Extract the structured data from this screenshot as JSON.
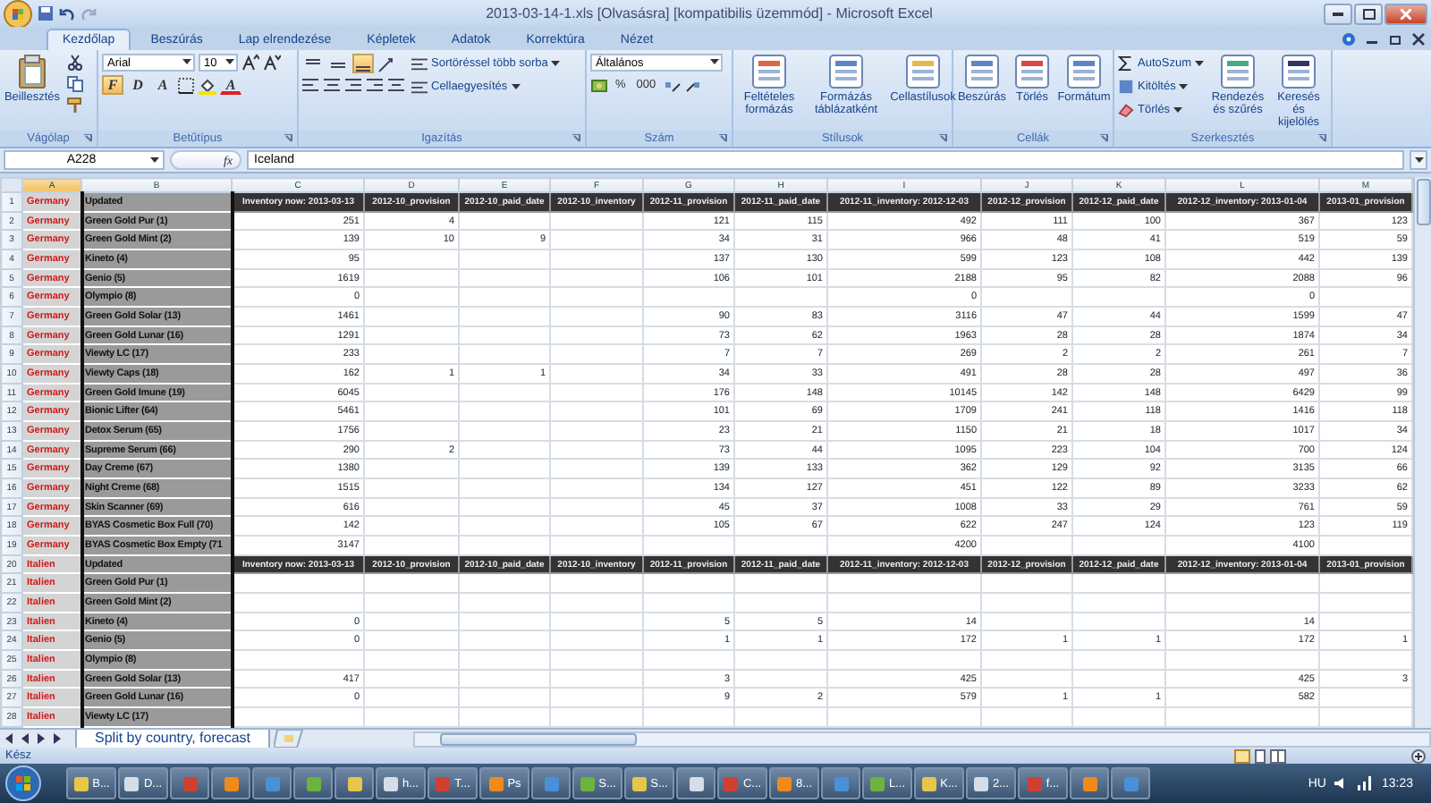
{
  "window": {
    "title": "2013-03-14-1.xls  [Olvasásra]  [kompatibilis üzemmód] - Microsoft Excel"
  },
  "ribbon": {
    "tabs": [
      {
        "label": "Kezdőlap",
        "selected": true
      },
      {
        "label": "Beszúrás",
        "selected": false
      },
      {
        "label": "Lap elrendezése",
        "selected": false
      },
      {
        "label": "Képletek",
        "selected": false
      },
      {
        "label": "Adatok",
        "selected": false
      },
      {
        "label": "Korrektúra",
        "selected": false
      },
      {
        "label": "Nézet",
        "selected": false
      }
    ],
    "groups": [
      {
        "title": "Vágólap",
        "buttons": [
          "Beillesztés"
        ]
      },
      {
        "title": "Betűtípus",
        "font": "Arial",
        "size": "10",
        "styles": [
          {
            "label": "F",
            "pressed": true
          },
          {
            "label": "D",
            "pressed": false
          },
          {
            "label": "A",
            "pressed": false
          }
        ],
        "font_color": "A"
      },
      {
        "title": "Igazítás",
        "alignments": [
          {
            "selected": false
          },
          {
            "selected": false
          },
          {
            "selected": true
          }
        ],
        "buttons": [
          "Sortöréssel több sorba",
          "Cellaegyesítés"
        ]
      },
      {
        "title": "Szám",
        "format": "Általános",
        "buttons": [
          "%",
          "000"
        ]
      },
      {
        "title": "Stílusok",
        "buttons": [
          "Feltételes formázás",
          "Formázás táblázatként",
          "Cellastílusok"
        ]
      },
      {
        "title": "Cellák",
        "buttons": [
          "Beszúrás",
          "Törlés",
          "Formátum"
        ]
      },
      {
        "title": "Szerkesztés",
        "buttons": [
          "AutoSzum",
          "Kitöltés",
          "Törlés",
          "Rendezés és szűrés",
          "Keresés és kijelölés"
        ]
      }
    ]
  },
  "formula_bar": {
    "name_box": "A228",
    "fx": "fx",
    "value": "Iceland"
  },
  "columns": [
    {
      "letter": "A",
      "selected": true
    },
    {
      "letter": "B",
      "selected": false
    },
    {
      "letter": "C",
      "selected": false
    },
    {
      "letter": "D",
      "selected": false
    },
    {
      "letter": "E",
      "selected": false
    },
    {
      "letter": "F",
      "selected": false
    },
    {
      "letter": "G",
      "selected": false
    },
    {
      "letter": "H",
      "selected": false
    },
    {
      "letter": "I",
      "selected": false
    },
    {
      "letter": "J",
      "selected": false
    },
    {
      "letter": "K",
      "selected": false
    },
    {
      "letter": "L",
      "selected": false
    },
    {
      "letter": "M",
      "selected": false
    }
  ],
  "rows": [
    {
      "number": "1",
      "kind": "header",
      "cells": [
        "Germany",
        "Updated",
        "Inventory now: 2013-03-13",
        "2012-10_provision",
        "2012-10_paid_date",
        "2012-10_inventory",
        "2012-11_provision",
        "2012-11_paid_date",
        "2012-11_inventory: 2012-12-03",
        "2012-12_provision",
        "2012-12_paid_date",
        "2012-12_inventory: 2013-01-04",
        "2013-01_provision"
      ]
    },
    {
      "number": "2",
      "kind": "data",
      "cells": [
        "Germany",
        "Green Gold Pur (1)",
        "251",
        "4",
        null,
        null,
        "121",
        "115",
        "492",
        "111",
        "100",
        "367",
        "123"
      ]
    },
    {
      "number": "3",
      "kind": "data",
      "cells": [
        "Germany",
        "Green Gold Mint (2)",
        "139",
        "10",
        "9",
        null,
        "34",
        "31",
        "966",
        "48",
        "41",
        "519",
        "59"
      ]
    },
    {
      "number": "4",
      "kind": "data",
      "cells": [
        "Germany",
        "Kineto (4)",
        "95",
        null,
        null,
        null,
        "137",
        "130",
        "599",
        "123",
        "108",
        "442",
        "139"
      ]
    },
    {
      "number": "5",
      "kind": "data",
      "cells": [
        "Germany",
        "Genio (5)",
        "1619",
        null,
        null,
        null,
        "106",
        "101",
        "2188",
        "95",
        "82",
        "2088",
        "96"
      ]
    },
    {
      "number": "6",
      "kind": "data",
      "cells": [
        "Germany",
        "Olympio (8)",
        "0",
        null,
        null,
        null,
        null,
        null,
        "0",
        null,
        null,
        "0",
        null
      ]
    },
    {
      "number": "7",
      "kind": "data",
      "cells": [
        "Germany",
        "Green Gold Solar (13)",
        "1461",
        null,
        null,
        null,
        "90",
        "83",
        "3116",
        "47",
        "44",
        "1599",
        "47"
      ]
    },
    {
      "number": "8",
      "kind": "data",
      "cells": [
        "Germany",
        "Green Gold Lunar (16)",
        "1291",
        null,
        null,
        null,
        "73",
        "62",
        "1963",
        "28",
        "28",
        "1874",
        "34"
      ]
    },
    {
      "number": "9",
      "kind": "data",
      "cells": [
        "Germany",
        "Viewty LC (17)",
        "233",
        null,
        null,
        null,
        "7",
        "7",
        "269",
        "2",
        "2",
        "261",
        "7"
      ]
    },
    {
      "number": "10",
      "kind": "data",
      "cells": [
        "Germany",
        "Viewty Caps (18)",
        "162",
        "1",
        "1",
        null,
        "34",
        "33",
        "491",
        "28",
        "28",
        "497",
        "36"
      ]
    },
    {
      "number": "11",
      "kind": "data",
      "cells": [
        "Germany",
        "Green Gold Imune (19)",
        "6045",
        null,
        null,
        null,
        "176",
        "148",
        "10145",
        "142",
        "148",
        "6429",
        "99"
      ]
    },
    {
      "number": "12",
      "kind": "data",
      "cells": [
        "Germany",
        "Bionic Lifter (64)",
        "5461",
        null,
        null,
        null,
        "101",
        "69",
        "1709",
        "241",
        "118",
        "1416",
        "118"
      ]
    },
    {
      "number": "13",
      "kind": "data",
      "cells": [
        "Germany",
        "Detox Serum (65)",
        "1756",
        null,
        null,
        null,
        "23",
        "21",
        "1150",
        "21",
        "18",
        "1017",
        "34"
      ]
    },
    {
      "number": "14",
      "kind": "data",
      "cells": [
        "Germany",
        "Supreme Serum (66)",
        "290",
        "2",
        null,
        null,
        "73",
        "44",
        "1095",
        "223",
        "104",
        "700",
        "124"
      ]
    },
    {
      "number": "15",
      "kind": "data",
      "cells": [
        "Germany",
        "Day Creme (67)",
        "1380",
        null,
        null,
        null,
        "139",
        "133",
        "362",
        "129",
        "92",
        "3135",
        "66"
      ]
    },
    {
      "number": "16",
      "kind": "data",
      "cells": [
        "Germany",
        "Night Creme (68)",
        "1515",
        null,
        null,
        null,
        "134",
        "127",
        "451",
        "122",
        "89",
        "3233",
        "62"
      ]
    },
    {
      "number": "17",
      "kind": "data",
      "cells": [
        "Germany",
        "Skin Scanner (69)",
        "616",
        null,
        null,
        null,
        "45",
        "37",
        "1008",
        "33",
        "29",
        "761",
        "59"
      ]
    },
    {
      "number": "18",
      "kind": "data",
      "cells": [
        "Germany",
        "BYAS Cosmetic Box Full (70)",
        "142",
        null,
        null,
        null,
        "105",
        "67",
        "622",
        "247",
        "124",
        "123",
        "119"
      ]
    },
    {
      "number": "19",
      "kind": "data",
      "cells": [
        "Germany",
        "BYAS Cosmetic Box Empty (71",
        "3147",
        null,
        null,
        null,
        null,
        null,
        "4200",
        null,
        null,
        "4100",
        null
      ]
    },
    {
      "number": "20",
      "kind": "header",
      "cells": [
        "Italien",
        "Updated",
        "Inventory now: 2013-03-13",
        "2012-10_provision",
        "2012-10_paid_date",
        "2012-10_inventory",
        "2012-11_provision",
        "2012-11_paid_date",
        "2012-11_inventory: 2012-12-03",
        "2012-12_provision",
        "2012-12_paid_date",
        "2012-12_inventory: 2013-01-04",
        "2013-01_provision"
      ]
    },
    {
      "number": "21",
      "kind": "data",
      "cells": [
        "Italien",
        "Green Gold Pur (1)",
        null,
        null,
        null,
        null,
        null,
        null,
        null,
        null,
        null,
        null,
        null
      ]
    },
    {
      "number": "22",
      "kind": "data",
      "cells": [
        "Italien",
        "Green Gold Mint (2)",
        null,
        null,
        null,
        null,
        null,
        null,
        null,
        null,
        null,
        null,
        null
      ]
    },
    {
      "number": "23",
      "kind": "data",
      "cells": [
        "Italien",
        "Kineto (4)",
        "0",
        null,
        null,
        null,
        "5",
        "5",
        "14",
        null,
        null,
        "14",
        null
      ]
    },
    {
      "number": "24",
      "kind": "data",
      "cells": [
        "Italien",
        "Genio (5)",
        "0",
        null,
        null,
        null,
        "1",
        "1",
        "172",
        "1",
        "1",
        "172",
        "1"
      ]
    },
    {
      "number": "25",
      "kind": "data",
      "cells": [
        "Italien",
        "Olympio (8)",
        null,
        null,
        null,
        null,
        null,
        null,
        null,
        null,
        null,
        null,
        null
      ]
    },
    {
      "number": "26",
      "kind": "data",
      "cells": [
        "Italien",
        "Green Gold Solar (13)",
        "417",
        null,
        null,
        null,
        "3",
        null,
        "425",
        null,
        null,
        "425",
        "3"
      ]
    },
    {
      "number": "27",
      "kind": "data",
      "cells": [
        "Italien",
        "Green Gold Lunar (16)",
        "0",
        null,
        null,
        null,
        "9",
        "2",
        "579",
        "1",
        "1",
        "582",
        null
      ]
    },
    {
      "number": "28",
      "kind": "data",
      "cells": [
        "Italien",
        "Viewty LC (17)",
        null,
        null,
        null,
        null,
        null,
        null,
        null,
        null,
        null,
        null,
        null
      ]
    }
  ],
  "sheet_tabs": [
    {
      "label": "Split by country, forecast",
      "selected": true
    }
  ],
  "status_bar": {
    "text": "Kész"
  },
  "taskbar": {
    "items": [
      {
        "kind": "app",
        "label": "B..."
      },
      {
        "kind": "app",
        "label": "D..."
      },
      {
        "kind": "icon"
      },
      {
        "kind": "icon"
      },
      {
        "kind": "icon"
      },
      {
        "kind": "icon"
      },
      {
        "kind": "icon"
      },
      {
        "kind": "app",
        "label": "h..."
      },
      {
        "kind": "app",
        "label": "T..."
      },
      {
        "kind": "app",
        "label": "Ps"
      },
      {
        "kind": "icon"
      },
      {
        "kind": "app",
        "label": "S..."
      },
      {
        "kind": "app",
        "label": "S..."
      },
      {
        "kind": "icon"
      },
      {
        "kind": "app",
        "label": "C..."
      },
      {
        "kind": "app",
        "label": "8..."
      },
      {
        "kind": "icon"
      },
      {
        "kind": "app",
        "label": "L..."
      },
      {
        "kind": "app",
        "label": "K..."
      },
      {
        "kind": "app",
        "label": "2..."
      },
      {
        "kind": "app",
        "label": "f..."
      },
      {
        "kind": "icon"
      },
      {
        "kind": "icon"
      }
    ],
    "language": "HU",
    "clock": "13:23"
  }
}
